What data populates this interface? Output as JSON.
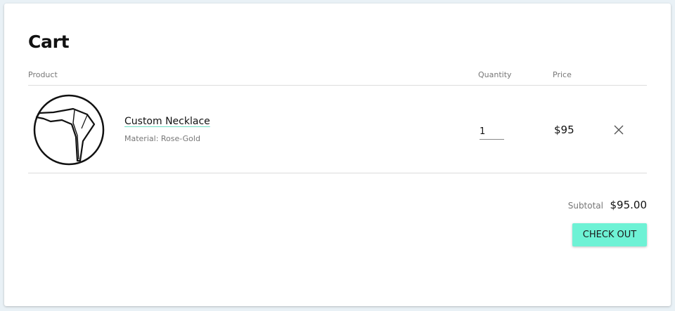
{
  "page": {
    "title": "Cart"
  },
  "table": {
    "headers": {
      "product": "Product",
      "quantity": "Quantity",
      "price": "Price"
    }
  },
  "items": [
    {
      "name": "Custom Necklace",
      "material": "Material: Rose-Gold",
      "quantity": "1",
      "price": "$95",
      "image_icon": "necklace-outline-icon",
      "remove_icon": "close-icon"
    }
  ],
  "summary": {
    "subtotal_label": "Subtotal",
    "subtotal_value": "$95.00"
  },
  "actions": {
    "checkout_label": "CHECK OUT"
  },
  "colors": {
    "accent": "#6ef2d5",
    "link_underline": "#6fe0c5",
    "background": "#e9f1f6"
  }
}
